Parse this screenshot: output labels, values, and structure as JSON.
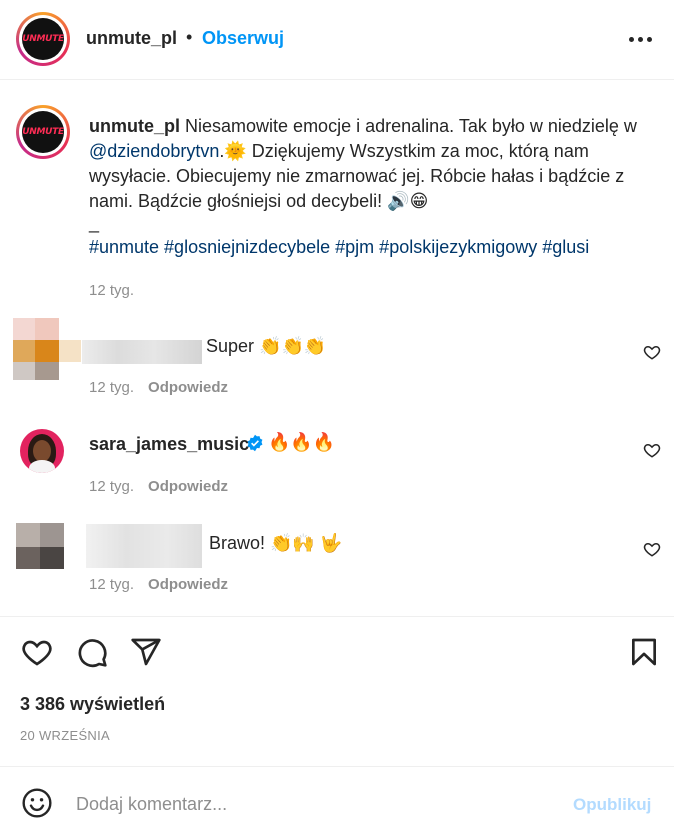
{
  "post": {
    "username": "unmute_pl",
    "separator": "•",
    "follow_label": "Obserwuj",
    "avatar_text": "UNMUTE"
  },
  "caption": {
    "username": "unmute_pl",
    "text_before": " Niesamowite emocje i adrenalina. Tak było w niedzielę w ",
    "mention": "@dziendobrytvn",
    "text_after": ".🌞 Dziękujemy Wszystkim za moc, którą nam wysyłacie. Obiecujemy nie zmarnować jej. Róbcie hałas i bądźcie z nami. Bądźcie głośniejsi od decybeli! 🔊😁",
    "dash": "_",
    "hashtags": "#unmute #glosniejnizdecybele #pjm #polskijezykmigowy #glusi",
    "time": "12 tyg."
  },
  "comments": [
    {
      "username": "",
      "text": "Super 👏👏👏",
      "time": "12 tyg.",
      "reply_label": "Odpowiedz"
    },
    {
      "username": "sara_james_music",
      "text": "🔥🔥🔥",
      "time": "12 tyg.",
      "reply_label": "Odpowiedz",
      "verified": true
    },
    {
      "username": "",
      "text": "Brawo! 👏🙌 🤟",
      "time": "12 tyg.",
      "reply_label": "Odpowiedz"
    }
  ],
  "footer": {
    "views": "3 386 wyświetleń",
    "date": "20 WRZEŚNIA",
    "comment_placeholder": "Dodaj komentarz...",
    "publish_label": "Opublikuj"
  },
  "colors": {
    "accent": "#0095f6",
    "link": "#00376b",
    "muted": "#8e8e8e",
    "publish_disabled": "#b3dbff"
  },
  "icons": [
    "more-icon",
    "heart-icon",
    "comment-icon",
    "share-icon",
    "bookmark-icon",
    "emoji-icon",
    "verified-icon",
    "like-comment-icon"
  ]
}
